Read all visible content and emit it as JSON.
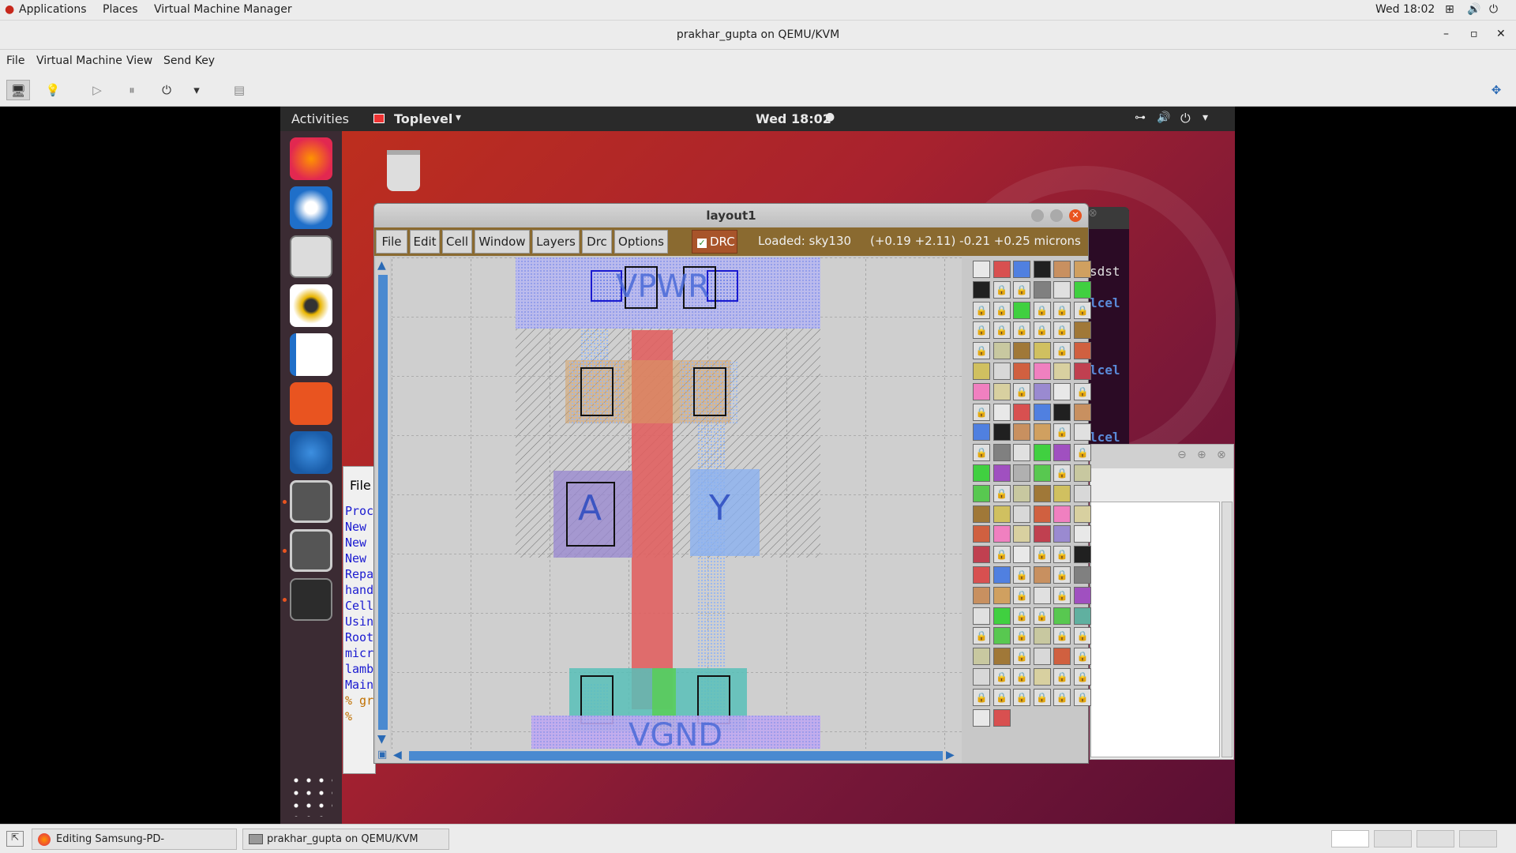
{
  "host": {
    "menus": [
      "Applications",
      "Places",
      "Virtual Machine Manager"
    ],
    "clock": "Wed 18:02",
    "window_title": "prakhar_gupta on QEMU/KVM",
    "vm_menu": [
      "File",
      "Virtual Machine",
      "View",
      "Send Key"
    ],
    "taskbar": [
      {
        "label": "Editing Samsung-PD-Training-/READ...",
        "icon": "firefox-icon"
      },
      {
        "label": "prakhar_gupta on QEMU/KVM",
        "icon": "vm-icon"
      }
    ]
  },
  "guest": {
    "activities": "Activities",
    "toplevel": "Toplevel",
    "clock": "Wed 18:02",
    "dock": [
      "firefox",
      "thunderbird",
      "files",
      "rhythmbox",
      "writer",
      "software",
      "help",
      "magic1",
      "magic2",
      "terminal",
      "app-grid"
    ]
  },
  "layout": {
    "title": "layout1",
    "menu": [
      "File",
      "Edit",
      "Cell",
      "Window",
      "Layers",
      "Drc",
      "Options"
    ],
    "drc": "DRC",
    "drc_checked": true,
    "status": "Loaded: sky130",
    "coords": "(+0.19 +2.11) -0.21 +0.25 microns",
    "labels": {
      "vpwr": "VPWR",
      "vgnd": "VGND",
      "a": "A",
      "y": "Y"
    }
  },
  "terminal": {
    "fragments": [
      "sdst",
      "lcel",
      "lcel",
      "lcel"
    ]
  },
  "tkcon": {
    "file": "File",
    "lines": [
      "Proc",
      "New",
      "New",
      "New",
      "Repa",
      "hand",
      "Cell",
      "Usin",
      "Root",
      "",
      "micr",
      "lamb",
      "Main",
      "% gr",
      "%"
    ]
  },
  "colors": {
    "accent": "#e95420",
    "magic_menu": "#8a6a30",
    "canvas": "#cfcfcf"
  }
}
